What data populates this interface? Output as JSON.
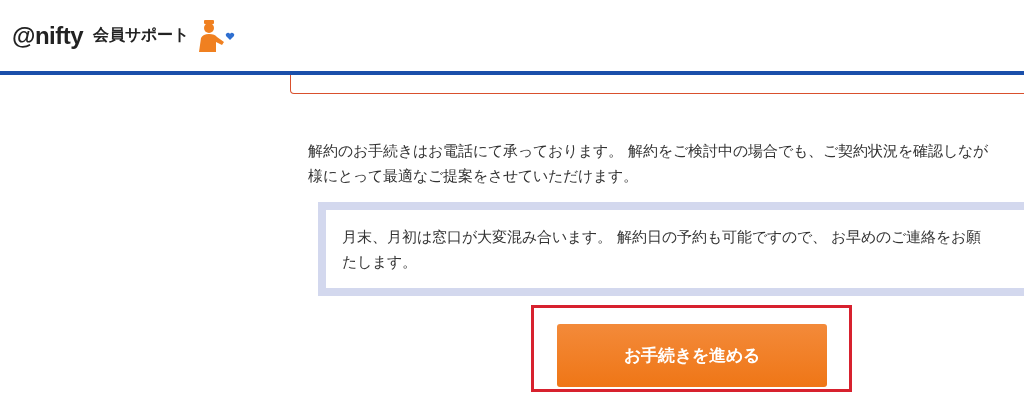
{
  "header": {
    "brand": "@nifty",
    "site_name": "会員サポート"
  },
  "intro": {
    "lines": [
      "解約のお手続きはお電話にて承っております。 解約をご検討中の場合でも、ご契約状況を確認しなが",
      "様にとって最適なご提案をさせていただけます。"
    ]
  },
  "note": {
    "lines": [
      "月末、月初は窓口が大変混み合います。 解約日の予約も可能ですので、 お早めのご連絡をお願",
      "たします。"
    ]
  },
  "action": {
    "label": "お手続きを進める",
    "highlighted": true
  }
}
